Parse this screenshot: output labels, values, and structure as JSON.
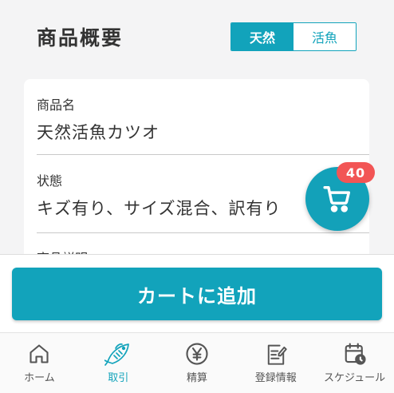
{
  "header": {
    "title": "商品概要",
    "toggle": [
      {
        "label": "天然",
        "selected": true
      },
      {
        "label": "活魚",
        "selected": false
      }
    ]
  },
  "product": {
    "name_label": "商品名",
    "name_value": "天然活魚カツオ",
    "status_label": "状態",
    "status_value": "キズ有り、サイズ混合、訳有り",
    "description_label": "商品説明"
  },
  "cart": {
    "badge_count": "40",
    "icon": "cart-icon"
  },
  "actions": {
    "add_to_cart": "カートに追加"
  },
  "tabs": [
    {
      "label": "ホーム",
      "icon": "home-icon",
      "active": false
    },
    {
      "label": "取引",
      "icon": "fish-icon",
      "active": true
    },
    {
      "label": "精算",
      "icon": "yen-icon",
      "active": false
    },
    {
      "label": "登録情報",
      "icon": "edit-document-icon",
      "active": false
    },
    {
      "label": "スケジュール",
      "icon": "calendar-clock-icon",
      "active": false
    }
  ],
  "colors": {
    "accent": "#12a3bb",
    "badge": "#f25555",
    "background": "#f4f4f5"
  }
}
